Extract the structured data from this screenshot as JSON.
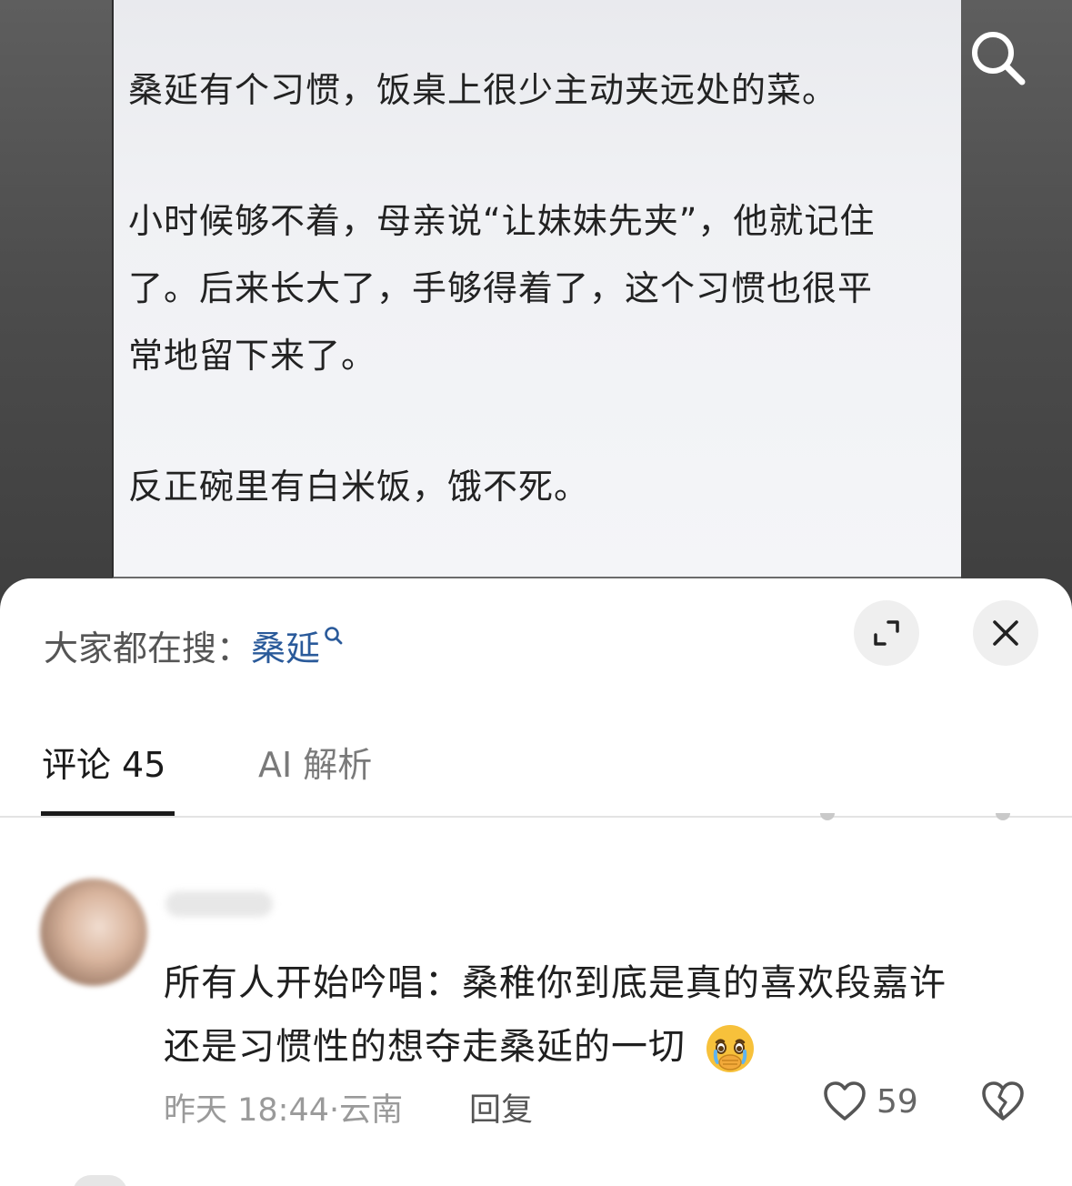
{
  "note": {
    "lines": [
      "桑延有个习惯，饭桌上很少主动夹远处的菜。",
      "小时候够不着，母亲说“让妹妹先夹”，他就记住",
      "了。后来长大了，手够得着了，这个习惯也很平",
      "常地留下来了。",
      "反正碗里有白米饭，饿不死。"
    ]
  },
  "header": {
    "search_icon": "search-icon"
  },
  "sheet": {
    "trending_prefix": "大家都在搜：",
    "trending_term": "桑延",
    "expand_icon": "expand-icon",
    "close_icon": "close-icon",
    "tabs": [
      {
        "label": "评论",
        "count": "45",
        "active": true
      },
      {
        "label_ai": "AI",
        "label_rest": "解析",
        "active": false
      }
    ]
  },
  "comment": {
    "text_line1": "所有人开始吟唱：桑稚你到底是真的喜欢段嘉许",
    "text_line2": "还是习惯性的想夺走桑延的一切",
    "emoji": "crying-face-emoji",
    "time": "昨天 18:44",
    "location": "云南",
    "reply_label": "回复",
    "likes": "59"
  },
  "colors": {
    "accent_link": "#2a5a9a",
    "text_primary": "#1f1f1f",
    "text_secondary": "#9a9a9a"
  }
}
